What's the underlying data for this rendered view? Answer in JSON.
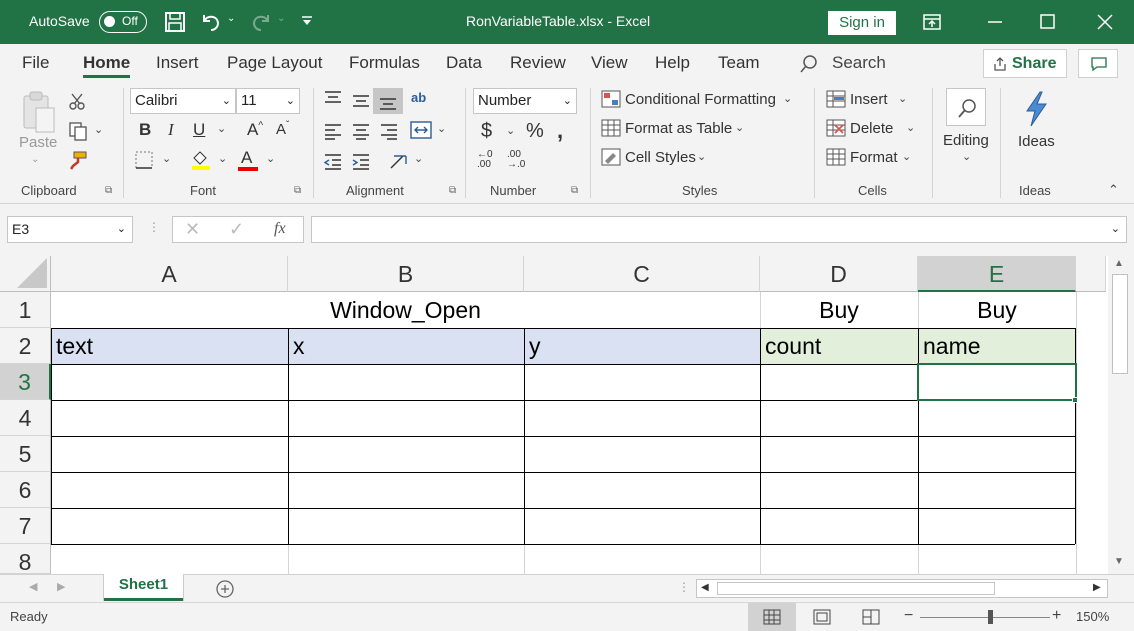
{
  "titlebar": {
    "autosave": "AutoSave",
    "toggle": "Off",
    "title": "RonVariableTable.xlsx  -  Excel",
    "signin": "Sign in"
  },
  "menu": {
    "items": [
      "File",
      "Home",
      "Insert",
      "Page Layout",
      "Formulas",
      "Data",
      "Review",
      "View",
      "Help",
      "Team"
    ],
    "search": "Search",
    "share": "Share"
  },
  "ribbon": {
    "paste": "Paste",
    "clipboard": "Clipboard",
    "font_name": "Calibri",
    "font_size": "11",
    "font": "Font",
    "alignment": "Alignment",
    "number_format": "Number",
    "number": "Number",
    "cond_format": "Conditional Formatting",
    "format_table": "Format as Table",
    "cell_styles": "Cell Styles",
    "styles": "Styles",
    "insert": "Insert",
    "delete": "Delete",
    "format": "Format",
    "cells": "Cells",
    "editing": "Editing",
    "ideas_btn": "Ideas",
    "ideas": "Ideas"
  },
  "formula": {
    "namebox": "E3",
    "fx": "fx",
    "value": ""
  },
  "grid": {
    "columns": [
      "A",
      "B",
      "C",
      "D",
      "E"
    ],
    "rows": [
      "1",
      "2",
      "3",
      "4",
      "5",
      "6",
      "7",
      "8"
    ],
    "r1": {
      "abc": "Window_Open",
      "d": "Buy",
      "e": "Buy"
    },
    "r2": {
      "a": "text",
      "b": "x",
      "c": "y",
      "d": "count",
      "e": "name"
    }
  },
  "sheets": {
    "active": "Sheet1"
  },
  "status": {
    "ready": "Ready",
    "zoom": "150%"
  },
  "colors": {
    "brand": "#217346",
    "blue_fill": "#d9e1f2",
    "green_fill": "#e2efda"
  }
}
